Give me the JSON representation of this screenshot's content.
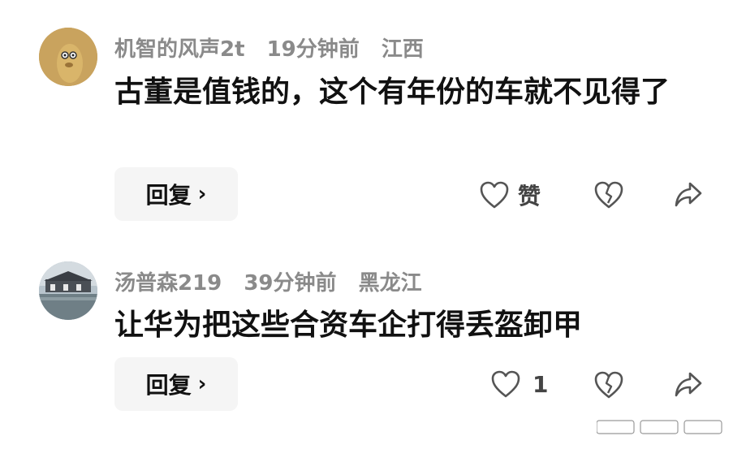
{
  "comments": [
    {
      "username": "机智的风声2t",
      "time": "19分钟前",
      "location": "江西",
      "text": "古董是值钱的，这个有年份的车就不见得了",
      "reply_label": "回复",
      "reply_chevron": "›",
      "like_label": "赞",
      "avatar_icon": "cartoon-face-avatar",
      "avatar_color": "#c8a15a"
    },
    {
      "username": "汤普森219",
      "time": "39分钟前",
      "location": "黑龙江",
      "text": "让华为把这些合资车企打得丢盔卸甲",
      "reply_label": "回复",
      "reply_chevron": "›",
      "like_count": "1",
      "avatar_icon": "building-landscape-avatar",
      "avatar_color": "#8a9aa8"
    }
  ],
  "icons": {
    "like": "heart-outline-icon",
    "dislike": "broken-heart-icon",
    "share": "share-arrow-icon"
  },
  "colors": {
    "meta_text": "#8a8a8a",
    "reply_bg": "#f5f5f5",
    "icon_stroke": "#555555"
  }
}
